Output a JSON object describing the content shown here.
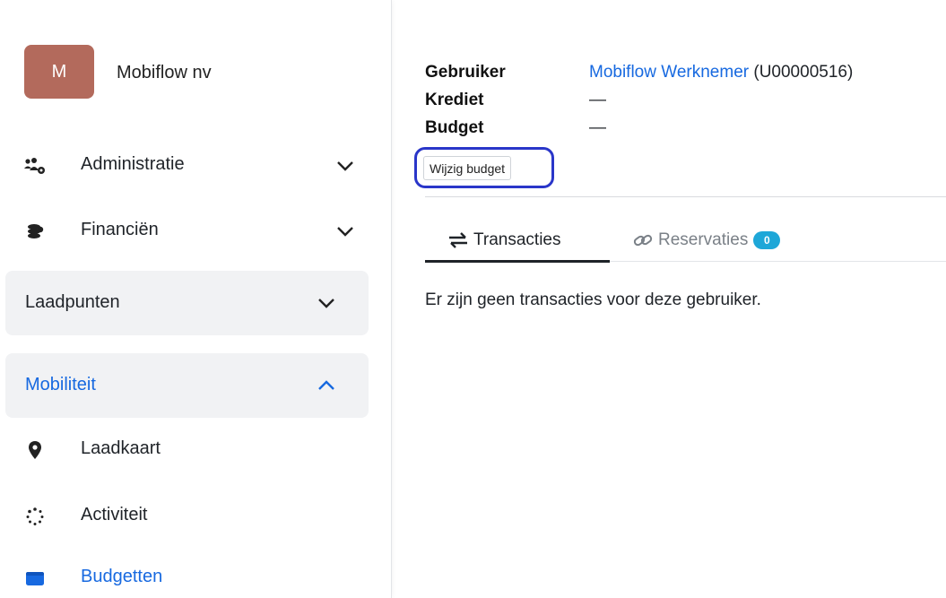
{
  "sidebar": {
    "org": {
      "initial": "M",
      "name": "Mobiflow nv"
    },
    "items": [
      {
        "label": "Administratie",
        "icon": "users-cog-icon"
      },
      {
        "label": "Financiën",
        "icon": "coins-icon"
      },
      {
        "label": "Laadpunten"
      },
      {
        "label": "Mobiliteit"
      },
      {
        "label": "Laadkaart",
        "icon": "map-pin-icon"
      },
      {
        "label": "Activiteit",
        "icon": "spinner-icon"
      },
      {
        "label": "Budgetten",
        "icon": "wallet-icon"
      }
    ]
  },
  "main": {
    "info": [
      {
        "key": "Gebruiker",
        "value_link": "Mobiflow Werknemer",
        "value_suffix": "(U00000516)"
      },
      {
        "key": "Krediet",
        "value": "—"
      },
      {
        "key": "Budget",
        "value": "—"
      }
    ],
    "edit_budget_button": "Wijzig budget",
    "tabs": [
      {
        "label": "Transacties",
        "icon": "arrows-exchange-icon"
      },
      {
        "label": "Reservaties",
        "icon": "link-icon",
        "badge": "0"
      }
    ],
    "empty_message": "Er zijn geen transacties voor deze gebruiker."
  },
  "colors": {
    "accent": "#1769e0",
    "avatar": "#b36a5c",
    "badge": "#1ea7d8",
    "highlight": "#2a36c9",
    "active_block_bg": "#f1f2f4"
  }
}
